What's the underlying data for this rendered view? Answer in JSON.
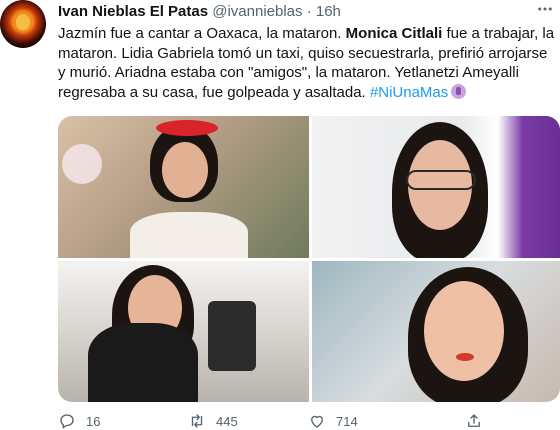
{
  "header": {
    "name": "Ivan Nieblas El Patas",
    "handle": "@ivannieblas",
    "separator": "·",
    "time": "16h",
    "more_icon": "ellipsis-icon"
  },
  "tweet": {
    "text_1": "Jazmín fue a cantar a Oaxaca, la mataron. ",
    "bold_name": "Monica Citlali",
    "text_2": " fue a trabajar, la mataron. Lidia Gabriela tomó un taxi, quiso secuestrarla, prefirió arrojarse y murió. Ariadna estaba con \"amigos\", la mataron. Yetlanetzi Ameyalli regresaba a su casa, fue golpeada y asaltada. ",
    "hashtag": "#NiUnaMas",
    "emoji": "purple-ribbon-emoji"
  },
  "media": {
    "photos": [
      "photo-1",
      "photo-2",
      "photo-3",
      "photo-4"
    ]
  },
  "actions": {
    "reply_count": "16",
    "retweet_count": "445",
    "like_count": "714",
    "reply_icon": "reply-icon",
    "retweet_icon": "retweet-icon",
    "like_icon": "heart-icon",
    "share_icon": "share-icon"
  },
  "colors": {
    "link": "#1d9bf0",
    "secondary_text": "#536471",
    "primary_text": "#0f1419"
  }
}
